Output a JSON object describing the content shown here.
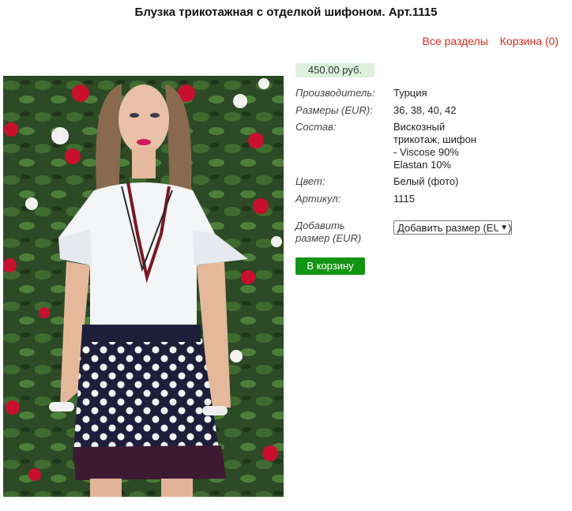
{
  "page": {
    "title": "Блузка трикотажная с отделкой шифоном. Арт.1115"
  },
  "nav": {
    "all_sections": "Все разделы",
    "cart": "Корзина (0)"
  },
  "product": {
    "price": "450.00 руб.",
    "attributes": [
      {
        "label": "Производитель:",
        "value": "Турция"
      },
      {
        "label": "Размеры (EUR):",
        "value": "36, 38, 40, 42"
      },
      {
        "label": "Состав:",
        "value_lines": [
          "Вискозный",
          "трикотаж, шифон",
          "- Viscose 90%",
          "Elastan 10%"
        ]
      },
      {
        "label": "Цвет:",
        "value": "Белый (фото)"
      },
      {
        "label": "Артикул:",
        "value": "1115"
      }
    ],
    "add_size_label_lines": [
      "Добавить",
      "размер (EUR)"
    ],
    "size_select_value": "Добавить размер (EUR)",
    "add_to_cart": "В корзину"
  },
  "colors": {
    "link": "#d52b1e",
    "price_bg": "#ddf1dd",
    "button_bg": "#139413"
  }
}
